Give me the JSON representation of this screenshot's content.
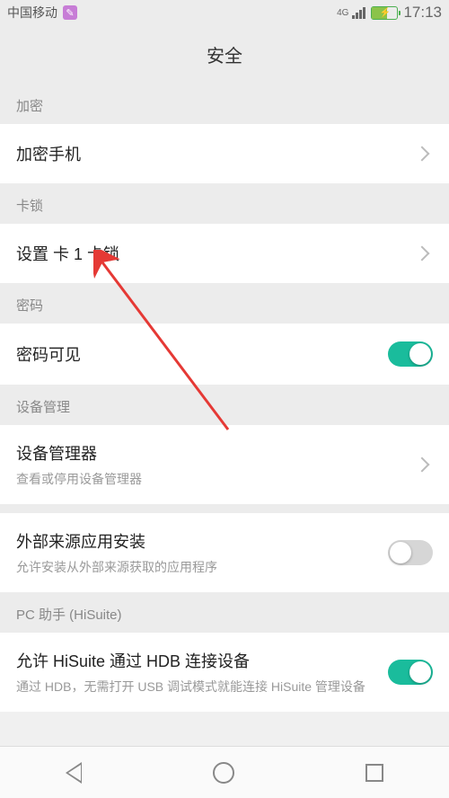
{
  "statusBar": {
    "carrier": "中国移动",
    "network": "4G",
    "time": "17:13"
  },
  "page": {
    "title": "安全"
  },
  "sections": {
    "encrypt": {
      "header": "加密",
      "item": "加密手机"
    },
    "cardLock": {
      "header": "卡锁",
      "item": "设置 卡 1 卡锁"
    },
    "password": {
      "header": "密码",
      "item": "密码可见",
      "enabled": true
    },
    "deviceMgmt": {
      "header": "设备管理",
      "admins": {
        "title": "设备管理器",
        "sub": "查看或停用设备管理器"
      },
      "unknown": {
        "title": "外部来源应用安装",
        "sub": "允许安装从外部来源获取的应用程序",
        "enabled": false
      }
    },
    "pcSuite": {
      "header": "PC 助手 (HiSuite)",
      "item": {
        "title": "允许 HiSuite 通过 HDB 连接设备",
        "sub": "通过 HDB，无需打开 USB 调试模式就能连接 HiSuite 管理设备",
        "enabled": true
      }
    }
  }
}
